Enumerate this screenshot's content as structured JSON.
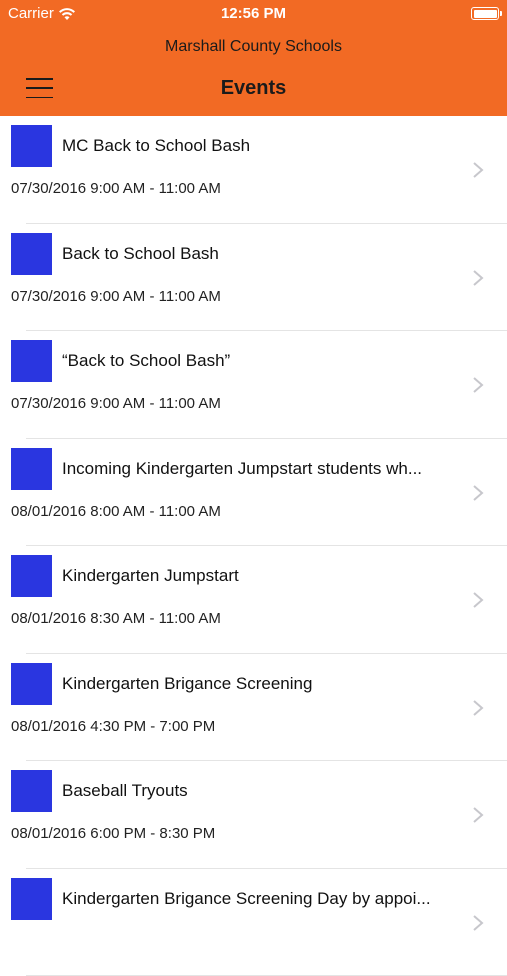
{
  "status_bar": {
    "carrier": "Carrier",
    "time": "12:56 PM",
    "wifi_icon": "wifi-icon",
    "battery_icon": "battery-icon"
  },
  "header": {
    "app_name": "Marshall County Schools",
    "title": "Events",
    "menu_icon": "hamburger-menu-icon",
    "background_color": "#f26a24"
  },
  "events": [
    {
      "title": "MC Back to School Bash",
      "time": "07/30/2016 9:00 AM - 11:00 AM"
    },
    {
      "title": "Back to School Bash",
      "time": "07/30/2016 9:00 AM - 11:00 AM"
    },
    {
      "title": "“Back to School Bash”",
      "time": "07/30/2016 9:00 AM - 11:00 AM"
    },
    {
      "title": "Incoming Kindergarten Jumpstart students wh...",
      "time": "08/01/2016 8:00 AM - 11:00 AM"
    },
    {
      "title": "Kindergarten Jumpstart",
      "time": "08/01/2016 8:30 AM - 11:00 AM"
    },
    {
      "title": "Kindergarten Brigance Screening",
      "time": "08/01/2016 4:30 PM - 7:00 PM"
    },
    {
      "title": "Baseball Tryouts",
      "time": "08/01/2016 6:00 PM - 8:30 PM"
    },
    {
      "title": "Kindergarten Brigance Screening Day by appoi...",
      "time": ""
    }
  ],
  "thumbnail_color": "#2a36e0"
}
